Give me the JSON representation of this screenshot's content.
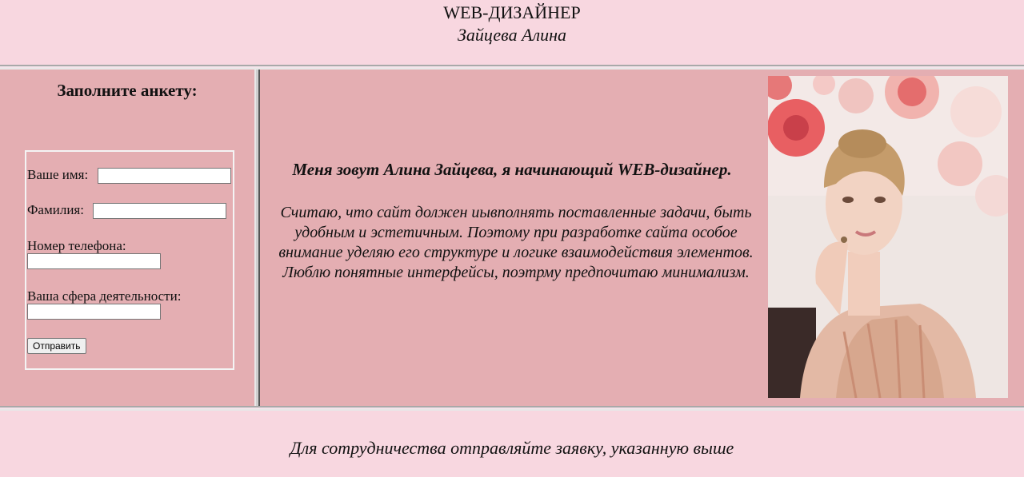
{
  "header": {
    "title": "WEB-ДИЗАЙНЕР",
    "subtitle": "Зайцева Алина"
  },
  "form": {
    "heading": "Заполните анкету:",
    "fields": [
      {
        "label": "Ваше имя:",
        "value": ""
      },
      {
        "label": "Фамилия:",
        "value": ""
      },
      {
        "label": "Номер телефона:",
        "value": ""
      },
      {
        "label": "Ваша сфера деятельности:",
        "value": ""
      }
    ],
    "submit_label": "Отправить"
  },
  "main": {
    "intro": "Меня зовут Алина Зайцева, я начинающий WEB-дизайнер.",
    "description": "Считаю, что сайт должен иывполнять поставленные задачи, быть удобным и эстетичным. Поэтому при разработке сайта особое внимание уделяю его структуре и логике взаимодействия элементов. Люблю понятные интерфейсы, поэтрму предпочитаю минимализм."
  },
  "footer": {
    "text": "Для сотрудничества отправляйте заявку, указанную выше"
  },
  "colors": {
    "page_background": "#f8d7e0",
    "panel_background": "#e4aeb2"
  }
}
